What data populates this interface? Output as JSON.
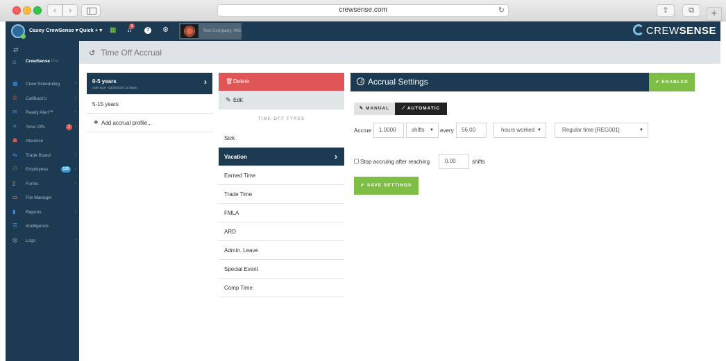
{
  "browser": {
    "url": "crewsense.com",
    "back_glyph": "‹",
    "forward_glyph": "›",
    "reload_glyph": "↻",
    "share_glyph": "⇪",
    "tabs_glyph": "⧉",
    "new_tab_glyph": "+"
  },
  "topbar": {
    "user_menu": "Casey CrewSense ▾",
    "quick_menu": "Quick + ▾",
    "notification_count": "1",
    "help_glyph": "?",
    "company_name": "Test Company, INC",
    "brand_light": "CREW",
    "brand_bold": "SENSE"
  },
  "sidebar": {
    "swap_glyph": "⇄",
    "home": {
      "label": "CrewSense",
      "suffix": "Pro",
      "icon": "home-icon"
    },
    "items": [
      {
        "label": "Crew Scheduling",
        "icon": "calendar-icon",
        "color": "#3a8ee6",
        "has_chevron": true
      },
      {
        "label": "CallBack's",
        "icon": "phone-icon",
        "color": "#e05555",
        "has_chevron": true
      },
      {
        "label": "Ready Alert™",
        "icon": "envelope-icon",
        "color": "#3a8ee6",
        "has_chevron": true
      },
      {
        "label": "Time Offs",
        "icon": "plane-icon",
        "color": "#3a8ee6",
        "has_chevron": true,
        "badge": "1",
        "badge_color": "#e05555"
      },
      {
        "label": "Absence",
        "icon": "user-minus-icon",
        "color": "#e05555",
        "has_chevron": false
      },
      {
        "label": "Trade Board",
        "icon": "shuffle-icon",
        "color": "#3a8ee6",
        "has_chevron": true
      },
      {
        "label": "Employees",
        "icon": "users-icon",
        "color": "#7fbe45",
        "has_chevron": true,
        "badge": "120",
        "badge_color": "#3a9ad9"
      },
      {
        "label": "Forms",
        "icon": "file-icon",
        "color": "#f0ad4e",
        "has_chevron": true
      },
      {
        "label": "File Manager",
        "icon": "folder-icon",
        "color": "#f0ad4e",
        "has_chevron": false
      },
      {
        "label": "Reports",
        "icon": "bar-chart-icon",
        "color": "#3a8ee6",
        "has_chevron": true
      },
      {
        "label": "Intelligence",
        "icon": "list-icon",
        "color": "#3a8ee6",
        "has_chevron": false
      },
      {
        "label": "Logs",
        "icon": "log-icon",
        "color": "#a4b5c3",
        "has_chevron": true
      }
    ]
  },
  "page": {
    "title": "Time Off Accrual"
  },
  "profiles": {
    "active": {
      "name": "0-5 years",
      "meta": "John Doe - 03/24/2015 11:06am"
    },
    "items": [
      "5-15 years"
    ],
    "add_label": "Add accrual profile..."
  },
  "types": {
    "delete_label": "Delete",
    "edit_label": "Edit",
    "heading": "TIME OFF TYPES",
    "items": [
      {
        "label": "Sick",
        "active": false
      },
      {
        "label": "Vacation",
        "active": true
      },
      {
        "label": "Earned Time",
        "active": false
      },
      {
        "label": "Trade Time",
        "active": false
      },
      {
        "label": "FMLA",
        "active": false
      },
      {
        "label": "ARD",
        "active": false
      },
      {
        "label": "Admin. Leave",
        "active": false
      },
      {
        "label": "Special Event",
        "active": false
      },
      {
        "label": "Comp Time",
        "active": false
      }
    ]
  },
  "settings": {
    "title": "Accrual Settings",
    "status": "✔ ENABLED",
    "mode_manual": "✎ MANUAL",
    "mode_automatic": "⟋ AUTOMATIC",
    "mode_selected": "automatic",
    "accrue_label": "Accrue",
    "accrue_amount": "1.0000",
    "accrue_unit": "shifts",
    "every_label": "every",
    "every_amount": "56.00",
    "every_unit": "hours worked",
    "time_code": "Regular time [REG001]",
    "stop_label": "Stop accruing after reaching",
    "stop_checked": false,
    "stop_amount": "0.00",
    "stop_unit_label": "shifts",
    "save_label": "✔ SAVE SETTINGS"
  },
  "colors": {
    "navy": "#1c3a52",
    "green": "#7fbe45",
    "red": "#e05555"
  }
}
